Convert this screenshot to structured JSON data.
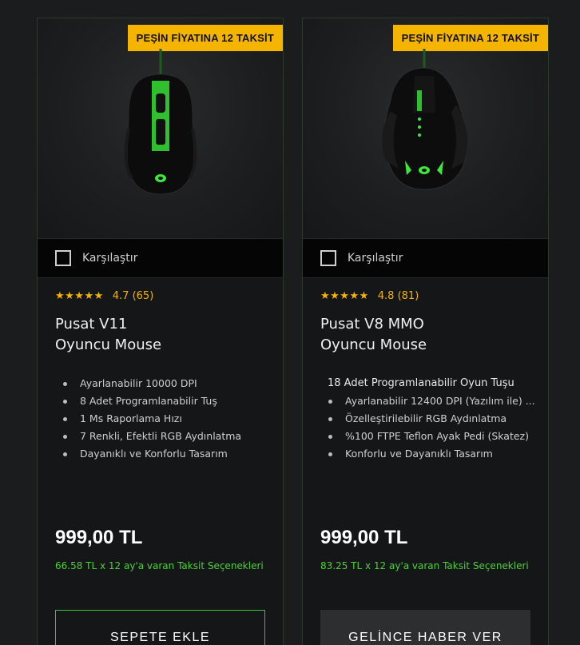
{
  "colors": {
    "accent_green": "#38c43c",
    "badge_yellow": "#f5b400",
    "background": "#1b1c1e"
  },
  "products": [
    {
      "badge": "PEŞİN FİYATINA 12 TAKSİT",
      "image_alt": "mouse-image",
      "compare_label": "Karşılaştır",
      "stars": "★★★★★",
      "rating": "4.7 (65)",
      "title_line1": "Pusat V11",
      "title_line2": "Oyuncu Mouse",
      "features": [
        "Ayarlanabilir 10000 DPI",
        "8 Adet Programlanabilir Tuş",
        "1 Ms Raporlama Hızı",
        "7 Renkli, Efektli RGB Aydınlatma",
        "Dayanıklı ve Konforlu Tasarım"
      ],
      "price": "999,00 TL",
      "installment": "66.58 TL x 12 ay'a varan Taksit Seçenekleri",
      "button_label": "SEPETE EKLE"
    },
    {
      "badge": "PEŞİN FİYATINA 12 TAKSİT",
      "image_alt": "mouse-image",
      "compare_label": "Karşılaştır",
      "stars": "★★★★★",
      "rating": "4.8 (81)",
      "title_line1": "Pusat V8 MMO",
      "title_line2": "Oyuncu Mouse",
      "features_lead": "18 Adet Programlanabilir Oyun Tuşu",
      "features": [
        "Ayarlanabilir 12400 DPI (Yazılım ile) ...",
        "Özelleştirilebilir RGB Aydınlatma",
        "%100 FTPE Teflon Ayak Pedi (Skatez)",
        "Konforlu ve Dayanıklı Tasarım"
      ],
      "price": "999,00 TL",
      "installment": "83.25 TL x 12 ay'a varan Taksit Seçenekleri",
      "button_label": "GELİNCE HABER VER"
    }
  ]
}
